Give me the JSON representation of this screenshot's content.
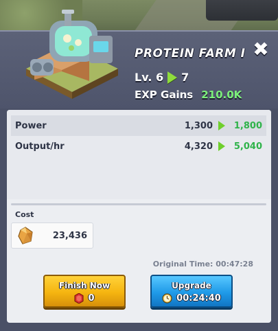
{
  "dialog": {
    "title": "PROTEIN FARM I",
    "level_label": "Lv. 6",
    "level_next": "7",
    "exp_label": "EXP Gains",
    "exp_value": "210.0K",
    "close_glyph": "✖"
  },
  "stats": [
    {
      "name": "Power",
      "from": "1,300",
      "to": "1,800"
    },
    {
      "name": "Output/hr",
      "from": "4,320",
      "to": "5,040"
    }
  ],
  "cost": {
    "label": "Cost",
    "icon": "food-crystal-icon",
    "amount": "23,436"
  },
  "original_time": "Original Time: 00:47:28",
  "buttons": {
    "finish_now": {
      "label": "Finish Now",
      "gem_count": "0",
      "icon": "gem-icon"
    },
    "upgrade": {
      "label": "Upgrade",
      "time": "00:24:40",
      "icon": "clock-icon"
    }
  },
  "colors": {
    "panel": "#4a5066",
    "card": "#eceef2",
    "green_value": "#2fb34a",
    "exp_green": "#7cf07a",
    "finish_yellow": "#f5b510",
    "upgrade_blue": "#1f9ae8"
  }
}
